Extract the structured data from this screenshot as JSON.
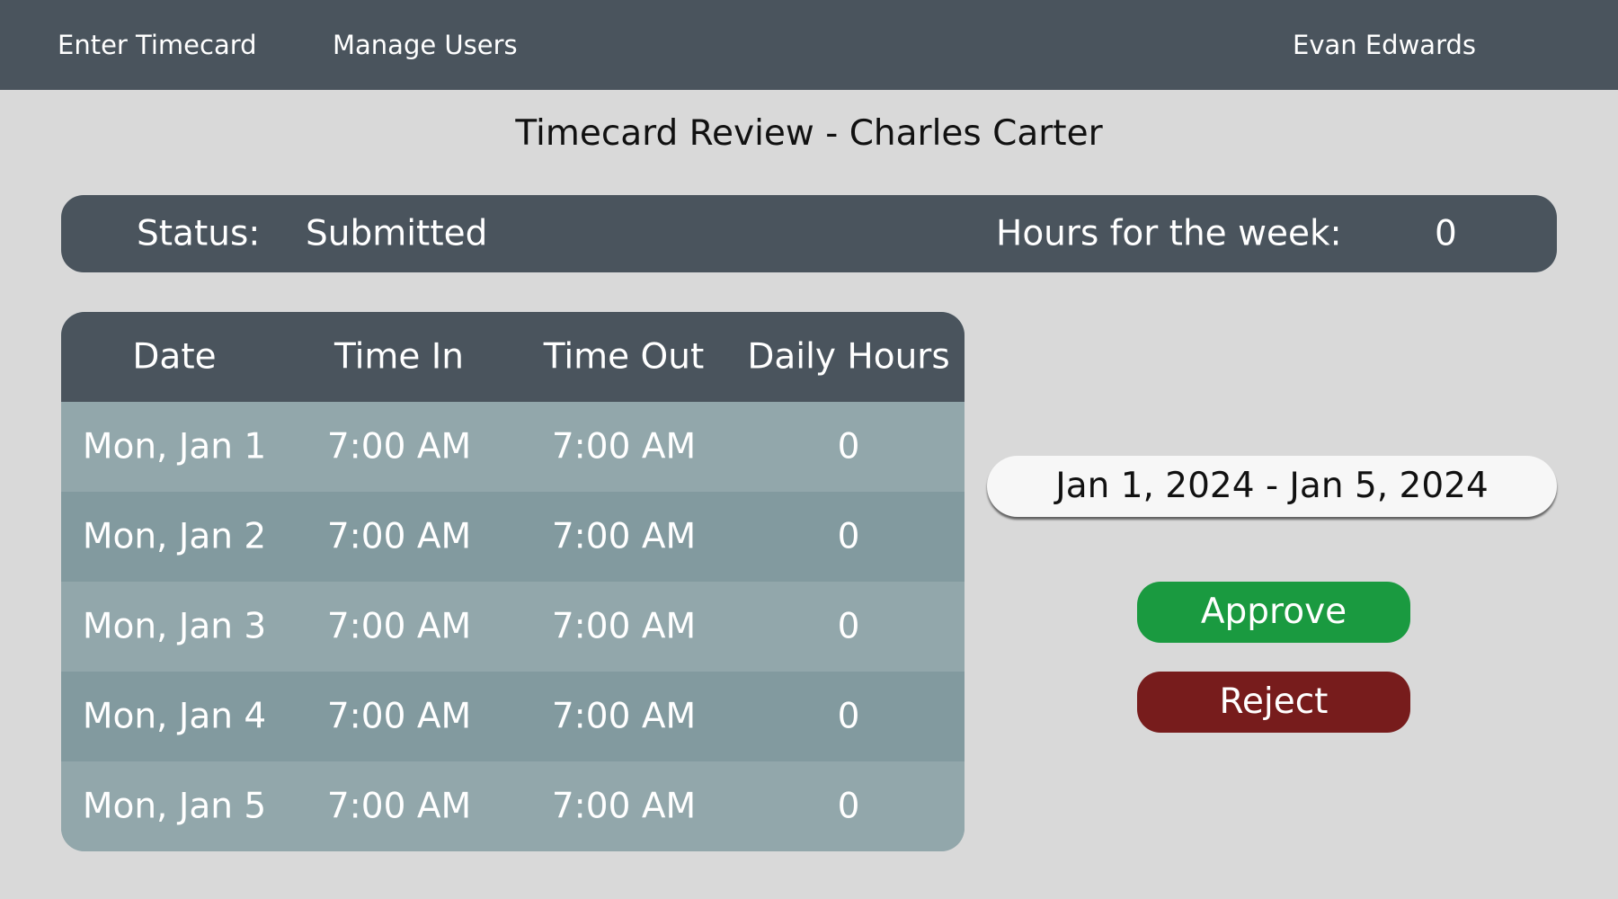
{
  "nav": {
    "enter_timecard": "Enter Timecard",
    "manage_users": "Manage Users",
    "user_name": "Evan Edwards"
  },
  "page": {
    "title": "Timecard Review - Charles Carter"
  },
  "status_bar": {
    "status_label": "Status:",
    "status_value": "Submitted",
    "hours_label": "Hours for the week:",
    "hours_value": "0"
  },
  "table": {
    "headers": [
      "Date",
      "Time In",
      "Time Out",
      "Daily Hours"
    ],
    "rows": [
      [
        "Mon, Jan 1",
        "7:00 AM",
        "7:00 AM",
        "0"
      ],
      [
        "Mon, Jan 2",
        "7:00 AM",
        "7:00 AM",
        "0"
      ],
      [
        "Mon, Jan 3",
        "7:00 AM",
        "7:00 AM",
        "0"
      ],
      [
        "Mon, Jan 4",
        "7:00 AM",
        "7:00 AM",
        "0"
      ],
      [
        "Mon, Jan 5",
        "7:00 AM",
        "7:00 AM",
        "0"
      ]
    ]
  },
  "date_range": "Jan 1, 2024 - Jan 5, 2024",
  "actions": {
    "approve": "Approve",
    "reject": "Reject"
  },
  "colors": {
    "nav_background": "#4a545d",
    "page_background": "#d9d9d9",
    "row_light": "#92a7ab",
    "row_dark": "#829a9f",
    "approve": "#1a9a40",
    "reject": "#771c1c"
  }
}
